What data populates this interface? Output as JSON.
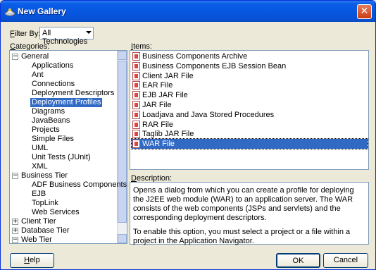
{
  "window": {
    "title": "New Gallery",
    "title_icon": "gallery-icon",
    "close_icon": "close-icon"
  },
  "filter": {
    "label_prefix": "F",
    "label_rest": "ilter By:",
    "value": "All Technologies"
  },
  "categories": {
    "label_prefix": "C",
    "label_rest": "ategories:",
    "rows": [
      {
        "text": "General",
        "level": 0,
        "expander": "−"
      },
      {
        "text": "Applications",
        "level": 1
      },
      {
        "text": "Ant",
        "level": 1
      },
      {
        "text": "Connections",
        "level": 1
      },
      {
        "text": "Deployment Descriptors",
        "level": 1
      },
      {
        "text": "Deployment Profiles",
        "level": 1,
        "selected": true
      },
      {
        "text": "Diagrams",
        "level": 1
      },
      {
        "text": "JavaBeans",
        "level": 1
      },
      {
        "text": "Projects",
        "level": 1
      },
      {
        "text": "Simple Files",
        "level": 1
      },
      {
        "text": "UML",
        "level": 1
      },
      {
        "text": "Unit Tests (JUnit)",
        "level": 1
      },
      {
        "text": "XML",
        "level": 1
      },
      {
        "text": "Business Tier",
        "level": 0,
        "expander": "−"
      },
      {
        "text": "ADF Business Components",
        "level": 1
      },
      {
        "text": "EJB",
        "level": 1
      },
      {
        "text": "TopLink",
        "level": 1
      },
      {
        "text": "Web Services",
        "level": 1
      },
      {
        "text": "Client Tier",
        "level": 0,
        "expander": "+"
      },
      {
        "text": "Database Tier",
        "level": 0,
        "expander": "+"
      },
      {
        "text": "Web Tier",
        "level": 0,
        "expander": "−"
      }
    ]
  },
  "items": {
    "label_prefix": "I",
    "label_rest": "tems:",
    "rows": [
      {
        "text": "Business Components Archive"
      },
      {
        "text": "Business Components EJB Session Bean"
      },
      {
        "text": "Client JAR File"
      },
      {
        "text": "EAR File"
      },
      {
        "text": "EJB JAR File"
      },
      {
        "text": "JAR File"
      },
      {
        "text": "Loadjava and Java Stored Procedures"
      },
      {
        "text": "RAR File"
      },
      {
        "text": "Taglib JAR File"
      },
      {
        "text": "WAR File",
        "selected": true
      }
    ]
  },
  "description": {
    "label_prefix": "D",
    "label_rest": "escription:",
    "para1": "Opens a dialog from which you can create a profile for deploying the J2EE web module (WAR) to an application server. The WAR consists of the web components (JSPs and servlets) and the corresponding deployment descriptors.",
    "para2": "To enable this option, you must select a project or a file within a project in the Application Navigator."
  },
  "buttons": {
    "help_prefix": "H",
    "help_rest": "elp",
    "ok": "OK",
    "cancel": "Cancel"
  }
}
